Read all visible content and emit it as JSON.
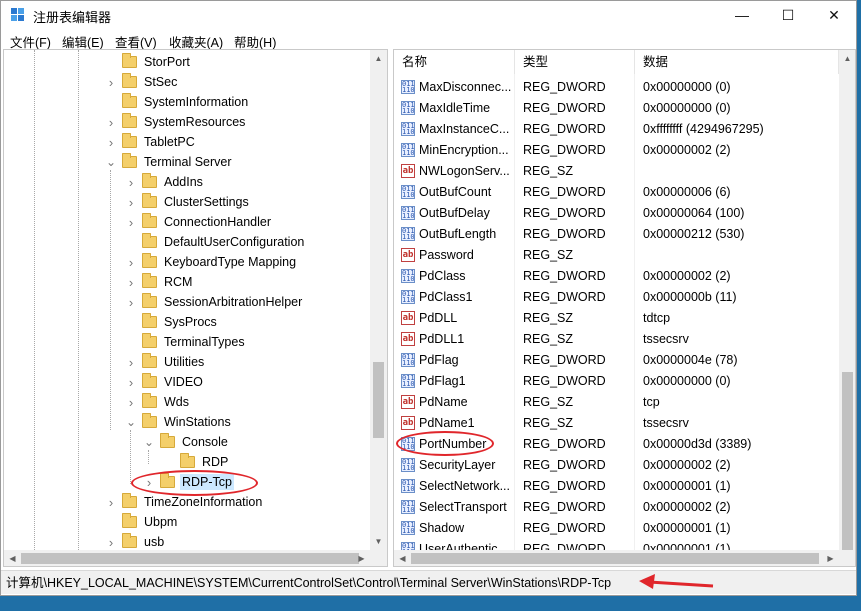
{
  "window": {
    "title": "注册表编辑器",
    "minimize_glyph": "—",
    "maximize_glyph": "☐",
    "close_glyph": "✕"
  },
  "menu": [
    "文件(F)",
    "编辑(E)",
    "查看(V)",
    "收藏夹(A)",
    "帮助(H)"
  ],
  "tree": [
    {
      "label": "StorPort",
      "level": 0,
      "caret": ""
    },
    {
      "label": "StSec",
      "level": 0,
      "caret": "collapsed"
    },
    {
      "label": "SystemInformation",
      "level": 0,
      "caret": ""
    },
    {
      "label": "SystemResources",
      "level": 0,
      "caret": "collapsed"
    },
    {
      "label": "TabletPC",
      "level": 0,
      "caret": "collapsed"
    },
    {
      "label": "Terminal Server",
      "level": 0,
      "caret": "expanded"
    },
    {
      "label": "AddIns",
      "level": 1,
      "caret": "collapsed"
    },
    {
      "label": "ClusterSettings",
      "level": 1,
      "caret": "collapsed"
    },
    {
      "label": "ConnectionHandler",
      "level": 1,
      "caret": "collapsed"
    },
    {
      "label": "DefaultUserConfiguration",
      "level": 1,
      "caret": ""
    },
    {
      "label": "KeyboardType Mapping",
      "level": 1,
      "caret": "collapsed"
    },
    {
      "label": "RCM",
      "level": 1,
      "caret": "collapsed"
    },
    {
      "label": "SessionArbitrationHelper",
      "level": 1,
      "caret": "collapsed"
    },
    {
      "label": "SysProcs",
      "level": 1,
      "caret": ""
    },
    {
      "label": "TerminalTypes",
      "level": 1,
      "caret": ""
    },
    {
      "label": "Utilities",
      "level": 1,
      "caret": "collapsed"
    },
    {
      "label": "VIDEO",
      "level": 1,
      "caret": "collapsed"
    },
    {
      "label": "Wds",
      "level": 1,
      "caret": "collapsed"
    },
    {
      "label": "WinStations",
      "level": 1,
      "caret": "expanded"
    },
    {
      "label": "Console",
      "level": 2,
      "caret": "expanded"
    },
    {
      "label": "RDP",
      "level": 3,
      "caret": ""
    },
    {
      "label": "RDP-Tcp",
      "level": 2,
      "caret": "collapsed",
      "selected": true
    },
    {
      "label": "TimeZoneInformation",
      "level": 0,
      "caret": "collapsed"
    },
    {
      "label": "Ubpm",
      "level": 0,
      "caret": ""
    },
    {
      "label": "usb",
      "level": 0,
      "caret": "collapsed"
    }
  ],
  "columns": {
    "name": "名称",
    "type": "类型",
    "data": "数据"
  },
  "values": [
    {
      "name": "MaxDisconnec...",
      "type": "REG_DWORD",
      "data": "0x00000000 (0)"
    },
    {
      "name": "MaxIdleTime",
      "type": "REG_DWORD",
      "data": "0x00000000 (0)"
    },
    {
      "name": "MaxInstanceC...",
      "type": "REG_DWORD",
      "data": "0xffffffff (4294967295)"
    },
    {
      "name": "MinEncryption...",
      "type": "REG_DWORD",
      "data": "0x00000002 (2)"
    },
    {
      "name": "NWLogonServ...",
      "type": "REG_SZ",
      "data": ""
    },
    {
      "name": "OutBufCount",
      "type": "REG_DWORD",
      "data": "0x00000006 (6)"
    },
    {
      "name": "OutBufDelay",
      "type": "REG_DWORD",
      "data": "0x00000064 (100)"
    },
    {
      "name": "OutBufLength",
      "type": "REG_DWORD",
      "data": "0x00000212 (530)"
    },
    {
      "name": "Password",
      "type": "REG_SZ",
      "data": ""
    },
    {
      "name": "PdClass",
      "type": "REG_DWORD",
      "data": "0x00000002 (2)"
    },
    {
      "name": "PdClass1",
      "type": "REG_DWORD",
      "data": "0x0000000b (11)"
    },
    {
      "name": "PdDLL",
      "type": "REG_SZ",
      "data": "tdtcp"
    },
    {
      "name": "PdDLL1",
      "type": "REG_SZ",
      "data": "tssecsrv"
    },
    {
      "name": "PdFlag",
      "type": "REG_DWORD",
      "data": "0x0000004e (78)"
    },
    {
      "name": "PdFlag1",
      "type": "REG_DWORD",
      "data": "0x00000000 (0)"
    },
    {
      "name": "PdName",
      "type": "REG_SZ",
      "data": "tcp"
    },
    {
      "name": "PdName1",
      "type": "REG_SZ",
      "data": "tssecsrv"
    },
    {
      "name": "PortNumber",
      "type": "REG_DWORD",
      "data": "0x00000d3d (3389)"
    },
    {
      "name": "SecurityLayer",
      "type": "REG_DWORD",
      "data": "0x00000002 (2)"
    },
    {
      "name": "SelectNetwork...",
      "type": "REG_DWORD",
      "data": "0x00000001 (1)"
    },
    {
      "name": "SelectTransport",
      "type": "REG_DWORD",
      "data": "0x00000002 (2)"
    },
    {
      "name": "Shadow",
      "type": "REG_DWORD",
      "data": "0x00000001 (1)"
    },
    {
      "name": "UserAuthentic...",
      "type": "REG_DWORD",
      "data": "0x00000001 (1)"
    }
  ],
  "dword_icon_text": "011\n110",
  "sz_icon_text": "ab",
  "status_path": "计算机\\HKEY_LOCAL_MACHINE\\SYSTEM\\CurrentControlSet\\Control\\Terminal Server\\WinStations\\RDP-Tcp",
  "annotation_color": "#e0262b"
}
